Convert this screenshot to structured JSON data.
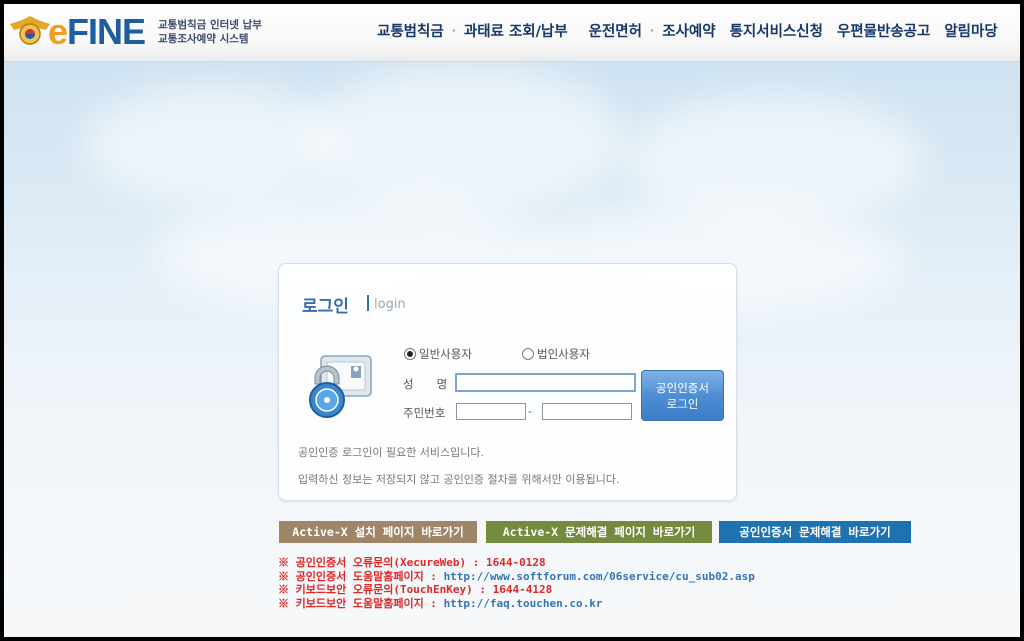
{
  "logo": {
    "brand": "eFINE",
    "sub_line1": "교통범칙금 인터넷 납부",
    "sub_line2": "교통조사예약 시스템"
  },
  "nav": {
    "items": [
      "교통범칙금",
      "과태료 조회/납부",
      "운전면허",
      "조사예약",
      "통지서비스신청",
      "우편물반송공고",
      "알림마당"
    ]
  },
  "login": {
    "title": "로그인",
    "subtitle": "login",
    "user_type_general": "일반사용자",
    "user_type_corporate": "법인사용자",
    "name_label": "성　　명",
    "ssn_label": "주민번호",
    "ssn_dash": "-",
    "cert_button_line1": "공인인증서",
    "cert_button_line2": "로그인",
    "note1": "공인인증 로그인이 필요한 서비스입니다.",
    "note2": "입력하신 정보는 저장되지 않고 공인인증 절차를 위해서만 이용됩니다."
  },
  "buttons": {
    "activex_install": "Active-X 설치 페이지 바로가기",
    "activex_troubleshoot": "Active-X 문제해결 페이지 바로가기",
    "cert_troubleshoot": "공인인증서 문제해결 바로가기"
  },
  "info": {
    "line1_red": "※ 공인인증서 오류문의(XecureWeb) : 1644-0128",
    "line2_red": "※ 공인인증서 도움말홈페이지 : ",
    "line2_link": "http://www.softforum.com/06service/cu_sub02.asp",
    "line3_red": "※ 키보드보안 오류문의(TouchEnKey) : 1644-4128",
    "line4_red": "※ 키보드보안 도움말홈페이지 : ",
    "line4_link": "http://faq.touchen.co.kr"
  },
  "colors": {
    "brand_blue": "#1f5e9e",
    "nav_text": "#17386b",
    "button_brown": "#a08668",
    "button_green": "#748a3e",
    "button_blue": "#1f72b0",
    "info_red": "#e02828",
    "link_blue": "#3573b6"
  }
}
